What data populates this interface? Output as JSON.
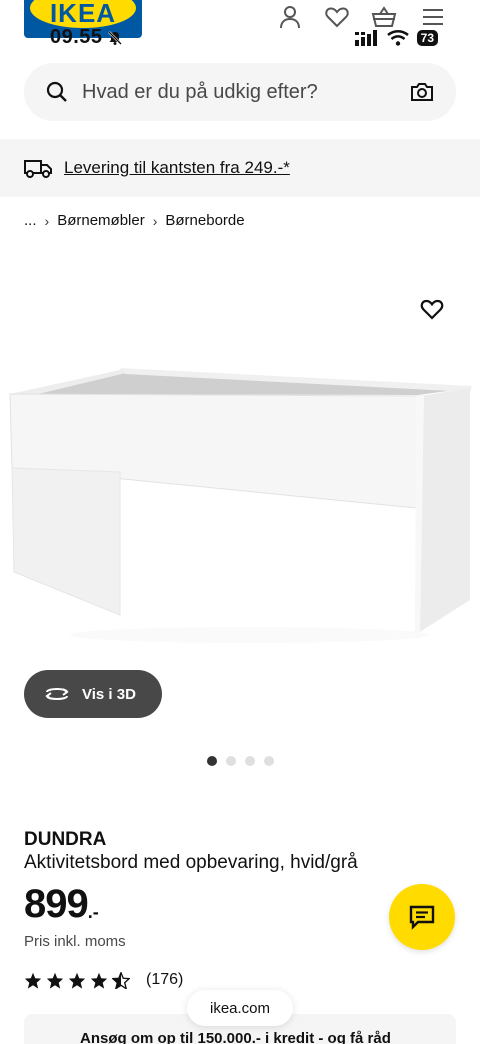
{
  "status_bar": {
    "time": "09.55",
    "battery": "73"
  },
  "header": {
    "logo_text": "IKEA"
  },
  "search": {
    "placeholder": "Hvad er du på udkig efter?"
  },
  "delivery": {
    "text": "Levering til kantsten fra 249.-*"
  },
  "breadcrumb": {
    "items": [
      "...",
      "Børnemøbler",
      "Børneborde"
    ]
  },
  "gallery": {
    "view_3d_label": "Vis i 3D",
    "dot_count": 4,
    "active_index": 0
  },
  "product": {
    "name": "DUNDRA",
    "description": "Aktivitetsbord med opbevaring, hvid/grå",
    "price": "899",
    "price_suffix": ".-",
    "price_note": "Pris inkl. moms",
    "rating": 4.5,
    "rating_count": "(176)"
  },
  "browser": {
    "url": "ikea.com"
  },
  "credit_banner": {
    "text": "Ansøg om op til 150.000.- i kredit - og få råd"
  },
  "colors": {
    "brand_blue": "#0058a3",
    "brand_yellow": "#ffdb00",
    "surface_grey": "#f5f5f5",
    "dark_button": "#484848"
  }
}
